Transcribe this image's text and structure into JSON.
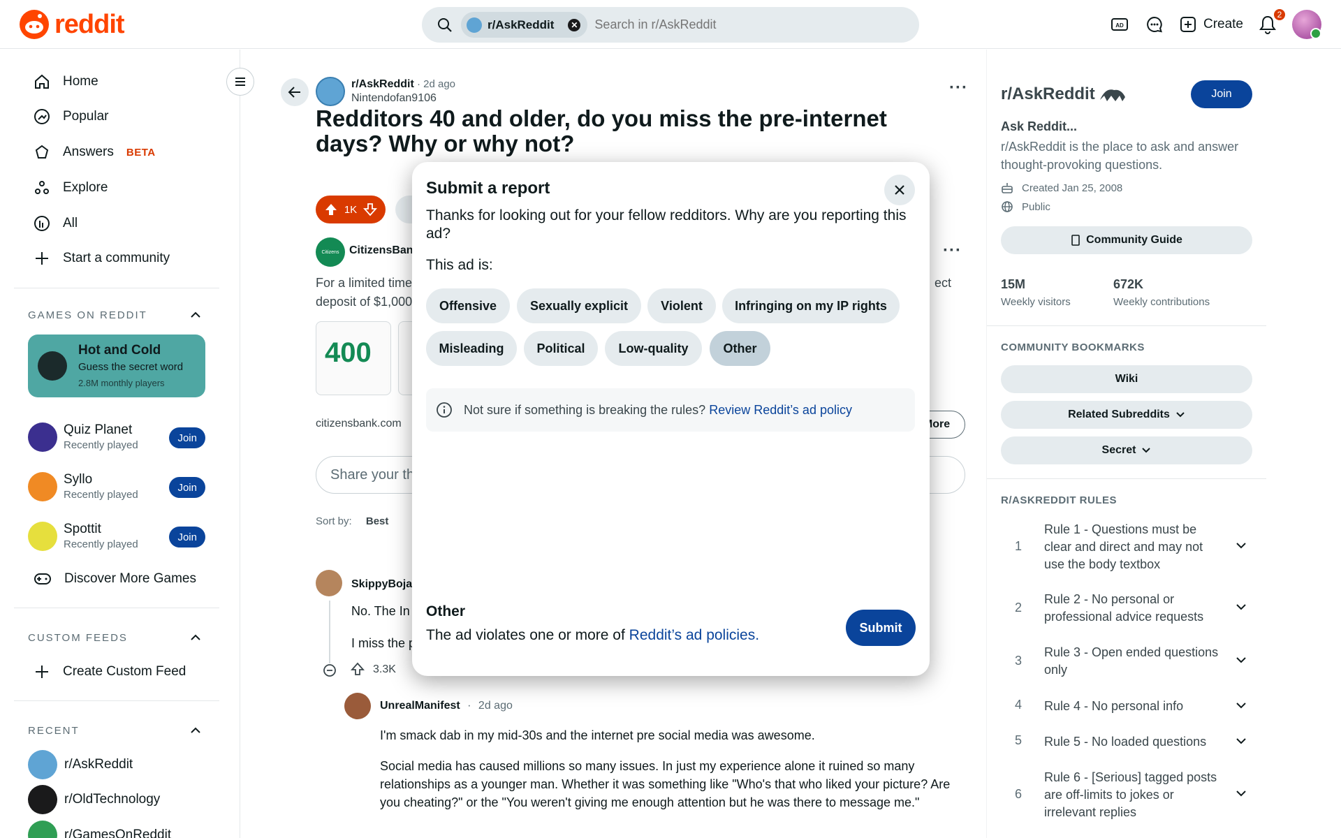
{
  "header": {
    "logo_text": "reddit",
    "search_chip": "r/AskReddit",
    "search_placeholder": "Search in r/AskReddit",
    "create_label": "Create",
    "notification_count": "2"
  },
  "sidebar": {
    "nav": [
      {
        "label": "Home",
        "icon": "home-icon"
      },
      {
        "label": "Popular",
        "icon": "popular-icon"
      },
      {
        "label": "Answers",
        "icon": "answers-icon",
        "badge": "BETA"
      },
      {
        "label": "Explore",
        "icon": "explore-icon"
      },
      {
        "label": "All",
        "icon": "all-icon"
      },
      {
        "label": "Start a community",
        "icon": "plus-icon"
      }
    ],
    "games_header": "GAMES ON REDDIT",
    "featured_game": {
      "title": "Hot and Cold",
      "subtitle": "Guess the secret word",
      "meta": "2.8M monthly players"
    },
    "games": [
      {
        "name": "Quiz Planet",
        "status": "Recently played",
        "join": "Join"
      },
      {
        "name": "Syllo",
        "status": "Recently played",
        "join": "Join"
      },
      {
        "name": "Spottit",
        "status": "Recently played",
        "join": "Join"
      }
    ],
    "discover_games": "Discover More Games",
    "custom_feeds_header": "CUSTOM FEEDS",
    "create_custom_feed": "Create Custom Feed",
    "recent_header": "RECENT",
    "recent": [
      "r/AskReddit",
      "r/OldTechnology",
      "r/GamesOnReddit"
    ]
  },
  "post": {
    "subreddit": "r/AskReddit",
    "time": "2d ago",
    "author": "Nintendofan9106",
    "title": "Redditors 40 and older, do you miss the pre-internet days? Why or why not?",
    "votes": "1K",
    "ad_name": "CitizensBan",
    "ad_text": "For a limited time",
    "ad_text_2": "deposit of $1,000",
    "ad_text_right": "ect",
    "ad_card_amount": "400",
    "ad_domain": "citizensbank.com",
    "more_label": "More",
    "share_placeholder": "Share your th",
    "sort_label": "Sort by:",
    "sort_value": "Best"
  },
  "comments": [
    {
      "author": "SkippyBoja",
      "text1": "No. The In",
      "text2": "I miss the p",
      "votes": "3.3K"
    },
    {
      "author": "UnrealManifest",
      "time": "2d ago",
      "text1": "I'm smack dab in my mid-30s and the internet pre social media was awesome.",
      "text2": "Social media has caused millions so many issues. In just my experience alone it ruined so many relationships as a younger man. Whether it was something like \"Who's that who liked your picture? Are you cheating?\" or the \"You weren't giving me enough attention but he was there to message me.\""
    }
  ],
  "community": {
    "name": "r/AskReddit",
    "join": "Join",
    "tagline": "Ask Reddit...",
    "description": "r/AskReddit is the place to ask and answer thought-provoking questions.",
    "created": "Created Jan 25, 2008",
    "visibility": "Public",
    "guide": "Community Guide",
    "visitors": "15M",
    "visitors_label": "Weekly visitors",
    "contributions": "672K",
    "contributions_label": "Weekly contributions",
    "bookmarks_header": "COMMUNITY BOOKMARKS",
    "bookmarks": [
      "Wiki",
      "Related Subreddits",
      "Secret"
    ],
    "rules_header": "R/ASKREDDIT RULES",
    "rules": [
      {
        "n": "1",
        "text": "Rule 1 - Questions must be clear and direct and may not use the body textbox"
      },
      {
        "n": "2",
        "text": "Rule 2 - No personal or professional advice requests"
      },
      {
        "n": "3",
        "text": "Rule 3 - Open ended questions only"
      },
      {
        "n": "4",
        "text": "Rule 4 - No personal info"
      },
      {
        "n": "5",
        "text": "Rule 5 - No loaded questions"
      },
      {
        "n": "6",
        "text": "Rule 6 - [Serious] tagged posts are off-limits to jokes or irrelevant replies"
      }
    ]
  },
  "modal": {
    "title": "Submit a report",
    "description": "Thanks for looking out for your fellow redditors. Why are you reporting this ad?",
    "label": "This ad is:",
    "options": [
      "Offensive",
      "Sexually explicit",
      "Violent",
      "Infringing on my IP rights",
      "Misleading",
      "Political",
      "Low-quality",
      "Other"
    ],
    "selected": "Other",
    "info_text": "Not sure if something is breaking the rules?",
    "info_link": "Review Reddit’s ad policy",
    "footer_title": "Other",
    "footer_text": "The ad violates one or more of",
    "footer_link": "Reddit’s ad policies.",
    "submit": "Submit"
  }
}
